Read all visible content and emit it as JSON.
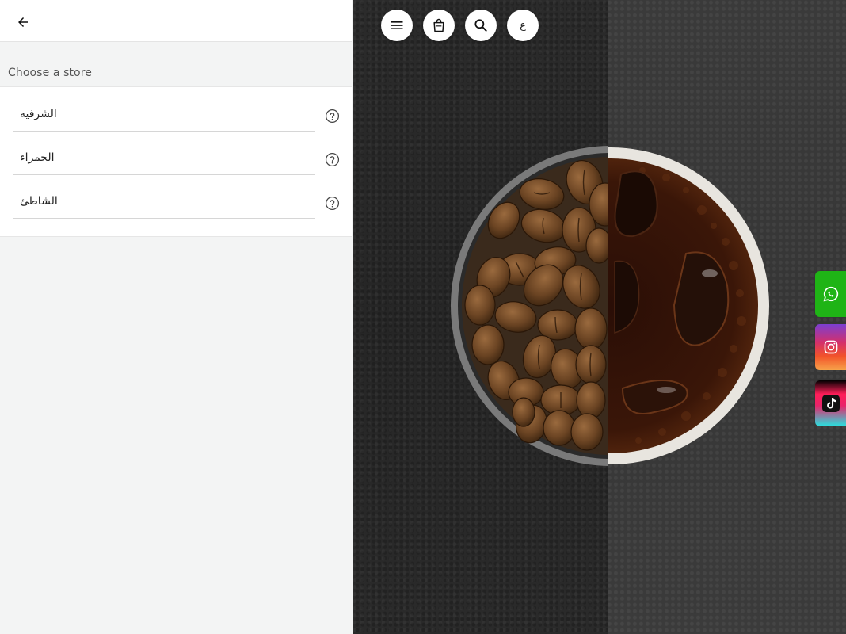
{
  "panel": {
    "section_title": "Choose a store",
    "stores": [
      {
        "name": "الشرفيه"
      },
      {
        "name": "الحمراء"
      },
      {
        "name": "الشاطئ"
      }
    ]
  },
  "toolbar": {
    "language_label": "ع"
  },
  "icons": {
    "back": "arrow-left-icon",
    "help": "question-circle-icon",
    "menu": "menu-icon",
    "cart": "shopping-bag-icon",
    "search": "search-icon",
    "whatsapp": "whatsapp-icon",
    "instagram": "instagram-icon",
    "tiktok": "tiktok-icon"
  },
  "colors": {
    "whatsapp": "#1fb416",
    "panel_bg": "#f3f4f4",
    "hero_dark": "#2a2a2a"
  }
}
